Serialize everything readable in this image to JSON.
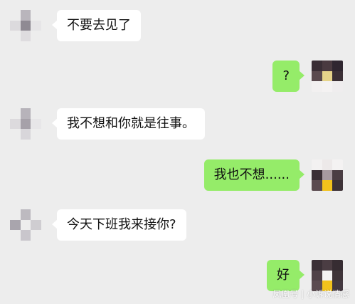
{
  "messages": [
    {
      "side": "in",
      "text": "不要去见了"
    },
    {
      "side": "out",
      "text": "?"
    },
    {
      "side": "in",
      "text": "我不想和你就是往事。"
    },
    {
      "side": "out",
      "text": "我也不想......"
    },
    {
      "side": "in",
      "text": "今天下班我来接你?"
    },
    {
      "side": "out",
      "text": "好"
    }
  ],
  "watermark": "凤凰号 | 小诉说情感",
  "colors": {
    "background": "#ededed",
    "incoming_bubble": "#ffffff",
    "outgoing_bubble": "#95ec69"
  }
}
